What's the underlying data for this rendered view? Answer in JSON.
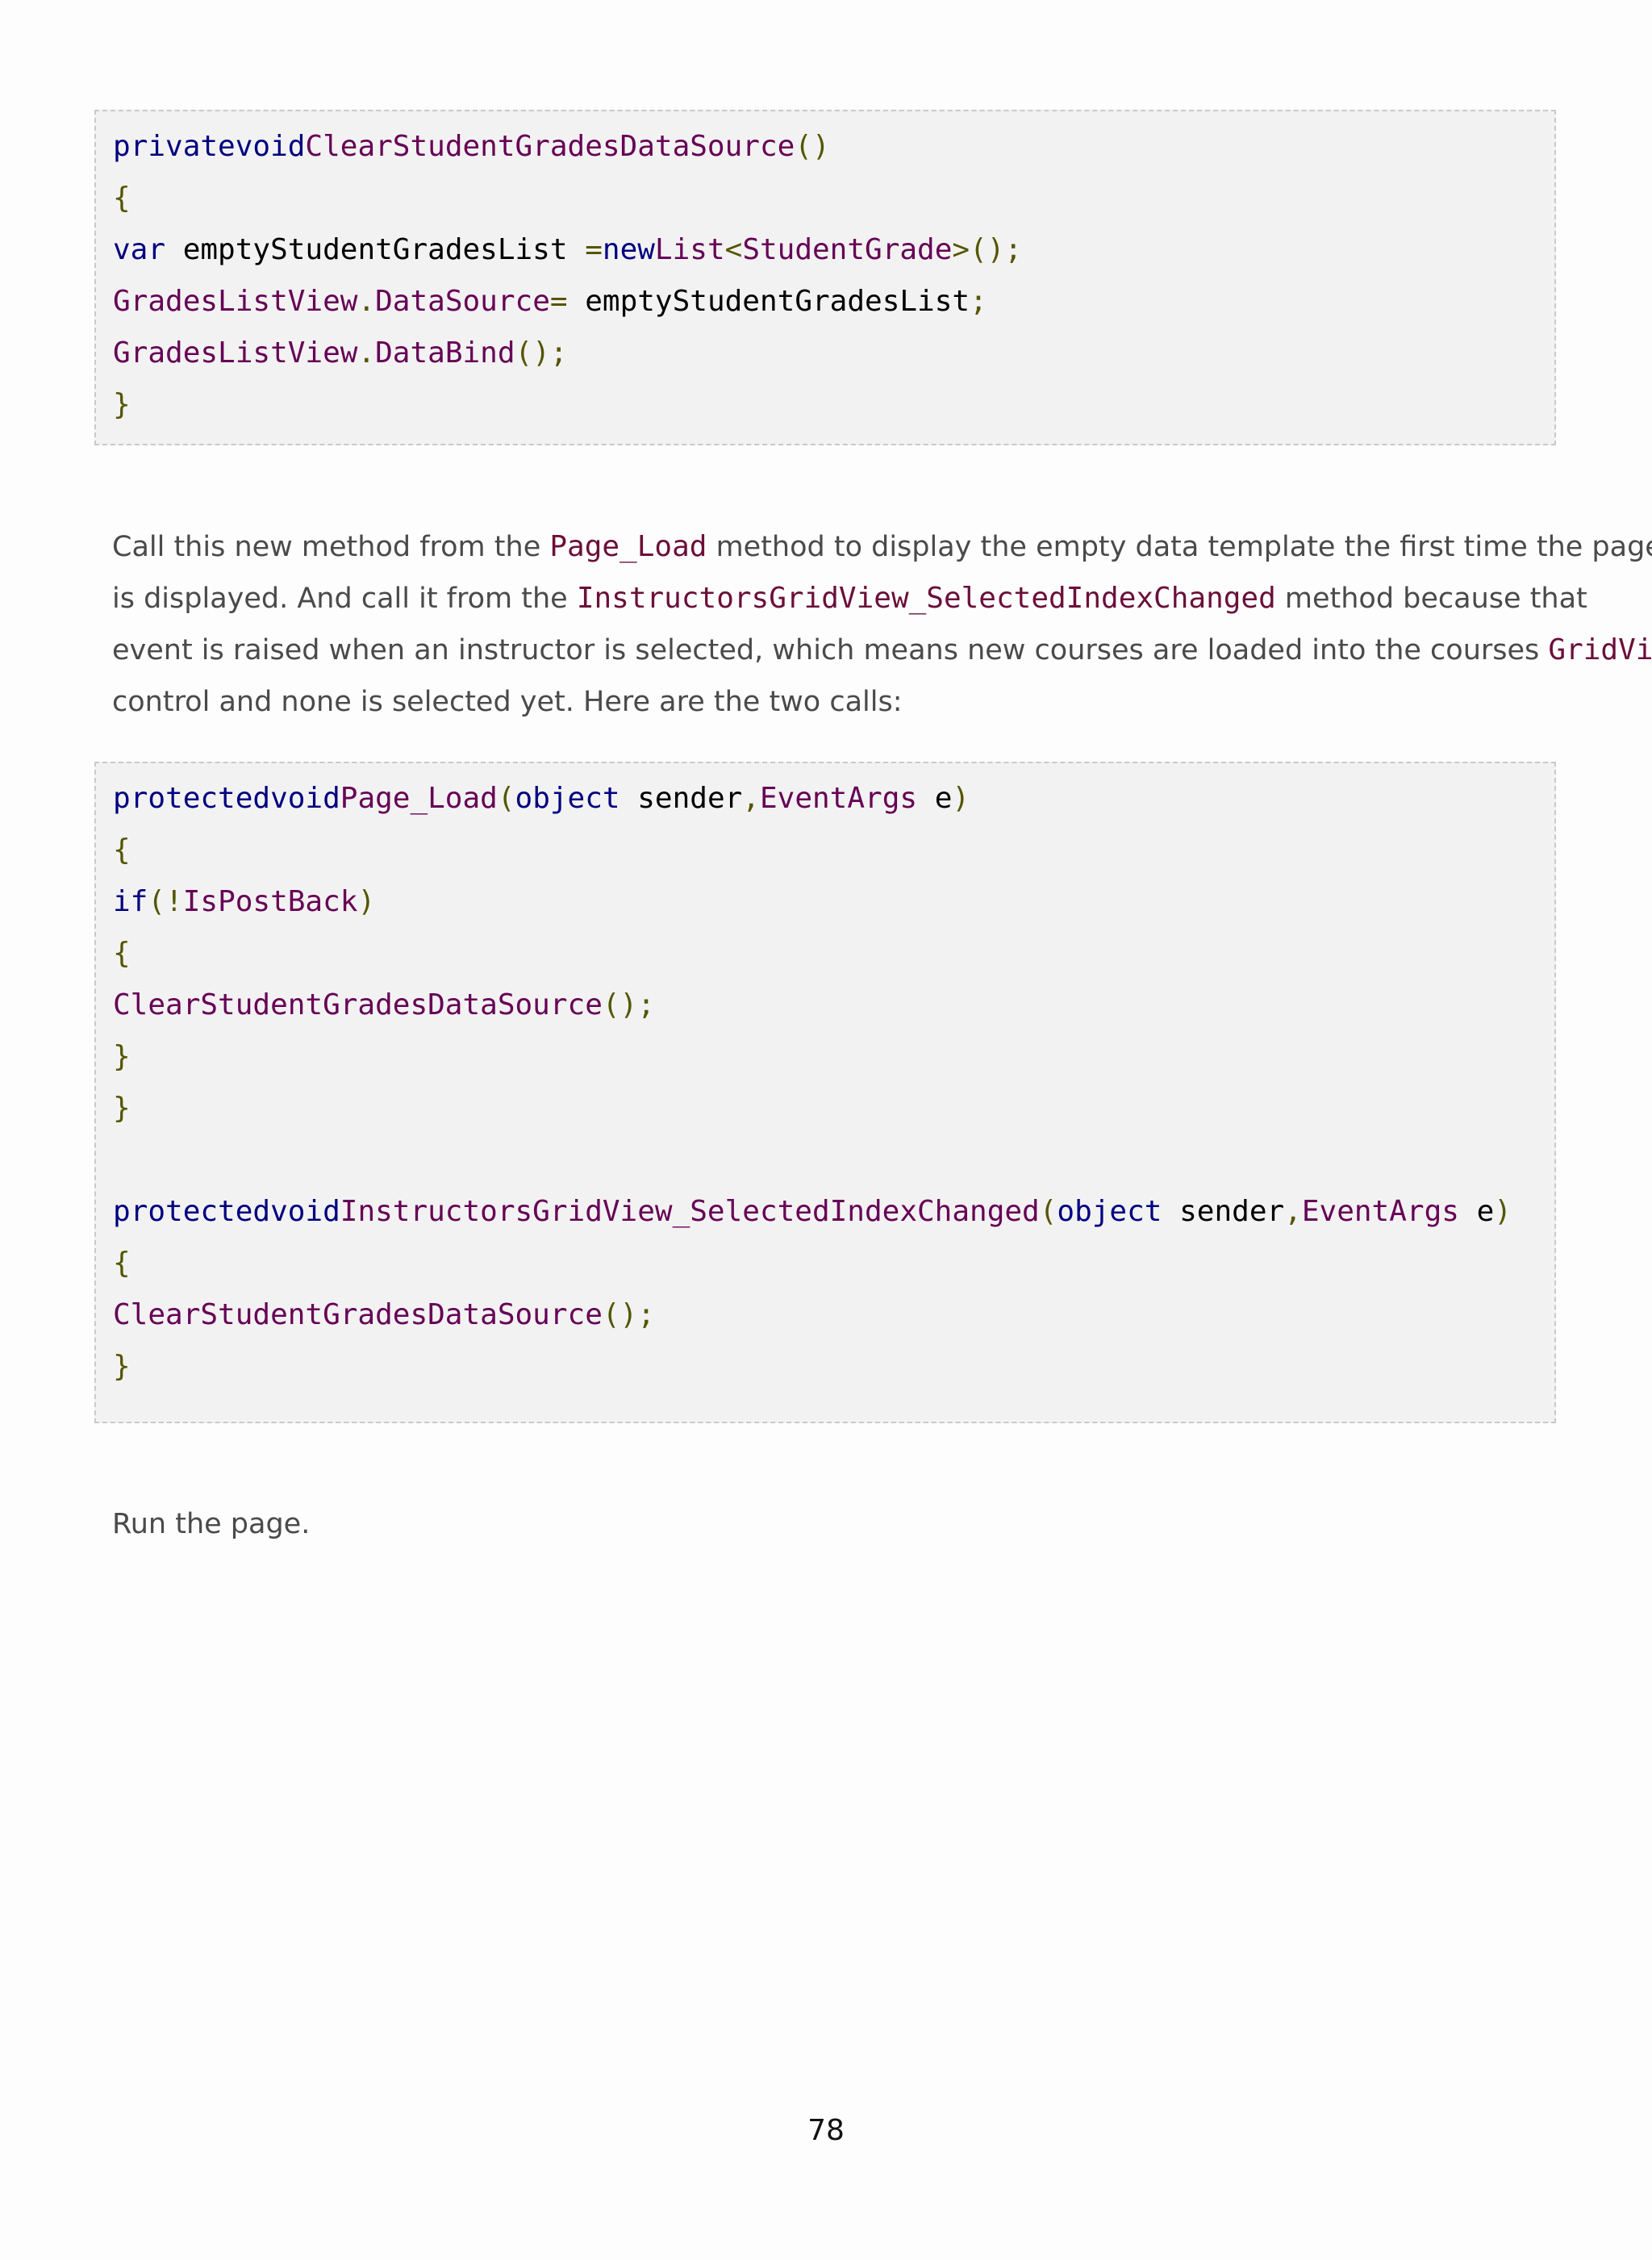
{
  "code_block_1": {
    "lines": [
      [
        {
          "t": "privatevoid",
          "c": "kw"
        },
        {
          "t": "ClearStudentGradesDataSource",
          "c": "id"
        },
        {
          "t": "()",
          "c": "pn"
        }
      ],
      [
        {
          "t": "{",
          "c": "pn"
        }
      ],
      [
        {
          "t": "var",
          "c": "kw"
        },
        {
          "t": " emptyStudentGradesList ",
          "c": "tx"
        },
        {
          "t": "=",
          "c": "pn"
        },
        {
          "t": "new",
          "c": "kw"
        },
        {
          "t": "List",
          "c": "id"
        },
        {
          "t": "<",
          "c": "pn"
        },
        {
          "t": "StudentGrade",
          "c": "id"
        },
        {
          "t": ">();",
          "c": "pn"
        }
      ],
      [
        {
          "t": "GradesListView",
          "c": "id"
        },
        {
          "t": ".",
          "c": "pn"
        },
        {
          "t": "DataSource",
          "c": "id"
        },
        {
          "t": "=",
          "c": "pn"
        },
        {
          "t": " emptyStudentGradesList",
          "c": "tx"
        },
        {
          "t": ";",
          "c": "pn"
        }
      ],
      [
        {
          "t": "GradesListView",
          "c": "id"
        },
        {
          "t": ".",
          "c": "pn"
        },
        {
          "t": "DataBind",
          "c": "id"
        },
        {
          "t": "();",
          "c": "pn"
        }
      ],
      [
        {
          "t": "}",
          "c": "pn"
        }
      ]
    ]
  },
  "paragraph_1": {
    "lines": [
      [
        {
          "t": "Call this new method from the "
        },
        {
          "t": "Page_Load",
          "code": true
        },
        {
          "t": " method to display the empty data template the first time the page"
        }
      ],
      [
        {
          "t": "is displayed. And call it from the "
        },
        {
          "t": "InstructorsGridView_SelectedIndexChanged",
          "code": true
        },
        {
          "t": " method because that"
        }
      ],
      [
        {
          "t": "event is raised when an instructor is selected, which means new courses are loaded into the courses "
        },
        {
          "t": "GridView",
          "code": true
        }
      ],
      [
        {
          "t": "control and none is selected yet. Here are the two calls:"
        }
      ]
    ]
  },
  "code_block_2": {
    "lines": [
      [
        {
          "t": "protectedvoid",
          "c": "kw"
        },
        {
          "t": "Page_Load",
          "c": "id"
        },
        {
          "t": "(",
          "c": "pn"
        },
        {
          "t": "object",
          "c": "kw"
        },
        {
          "t": " sender",
          "c": "tx"
        },
        {
          "t": ",",
          "c": "pn"
        },
        {
          "t": "EventArgs",
          "c": "id"
        },
        {
          "t": " e",
          "c": "tx"
        },
        {
          "t": ")",
          "c": "pn"
        }
      ],
      [
        {
          "t": "{",
          "c": "pn"
        }
      ],
      [
        {
          "t": "if",
          "c": "kw"
        },
        {
          "t": "(!",
          "c": "pn"
        },
        {
          "t": "IsPostBack",
          "c": "id"
        },
        {
          "t": ")",
          "c": "pn"
        }
      ],
      [
        {
          "t": "{",
          "c": "pn"
        }
      ],
      [
        {
          "t": "ClearStudentGradesDataSource",
          "c": "id"
        },
        {
          "t": "();",
          "c": "pn"
        }
      ],
      [
        {
          "t": "}",
          "c": "pn"
        }
      ],
      [
        {
          "t": "}",
          "c": "pn"
        }
      ],
      [],
      [
        {
          "t": "protectedvoid",
          "c": "kw"
        },
        {
          "t": "InstructorsGridView_SelectedIndexChanged",
          "c": "id"
        },
        {
          "t": "(",
          "c": "pn"
        },
        {
          "t": "object",
          "c": "kw"
        },
        {
          "t": " sender",
          "c": "tx"
        },
        {
          "t": ",",
          "c": "pn"
        },
        {
          "t": "EventArgs",
          "c": "id"
        },
        {
          "t": " e",
          "c": "tx"
        },
        {
          "t": ")",
          "c": "pn"
        }
      ],
      [
        {
          "t": "{",
          "c": "pn"
        }
      ],
      [
        {
          "t": "ClearStudentGradesDataSource",
          "c": "id"
        },
        {
          "t": "();",
          "c": "pn"
        }
      ],
      [
        {
          "t": "}",
          "c": "pn"
        }
      ]
    ]
  },
  "paragraph_2": {
    "text": "Run the page."
  },
  "page_number": "78"
}
